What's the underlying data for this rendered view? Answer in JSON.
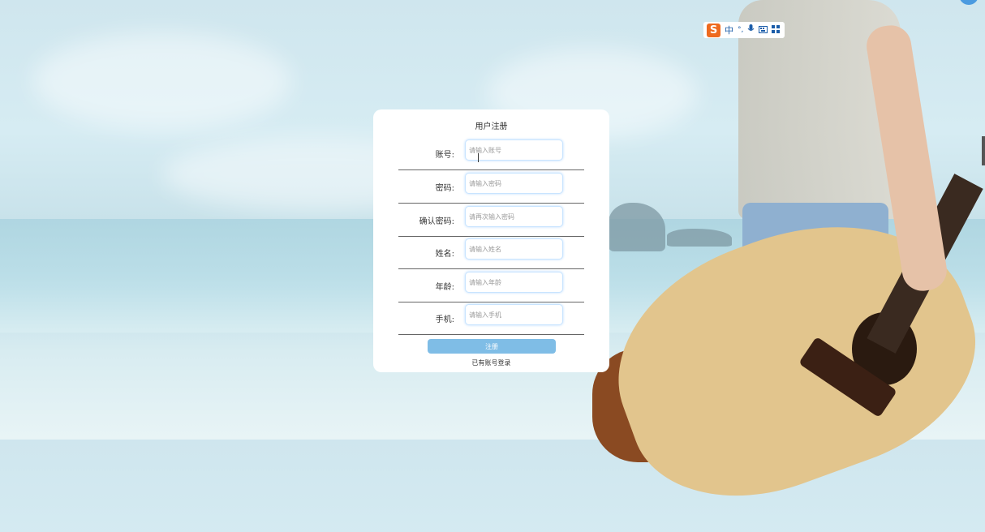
{
  "ime_toolbar": {
    "logo": "S",
    "mode": "中",
    "items": [
      "°,",
      "mic-icon",
      "keyboard-icon",
      "grid-icon"
    ]
  },
  "form": {
    "title": "用户注册",
    "fields": [
      {
        "label": "账号:",
        "placeholder": "请输入账号"
      },
      {
        "label": "密码:",
        "placeholder": "请输入密码"
      },
      {
        "label": "确认密码:",
        "placeholder": "请再次输入密码"
      },
      {
        "label": "姓名:",
        "placeholder": "请输入姓名"
      },
      {
        "label": "年龄:",
        "placeholder": "请输入年龄"
      },
      {
        "label": "手机:",
        "placeholder": "请输入手机"
      }
    ],
    "submit_label": "注册",
    "login_link": "已有账号登录"
  },
  "colors": {
    "button": "#7fbde6",
    "input_border": "#c8e4ff",
    "ime_logo": "#ee6a1f"
  }
}
